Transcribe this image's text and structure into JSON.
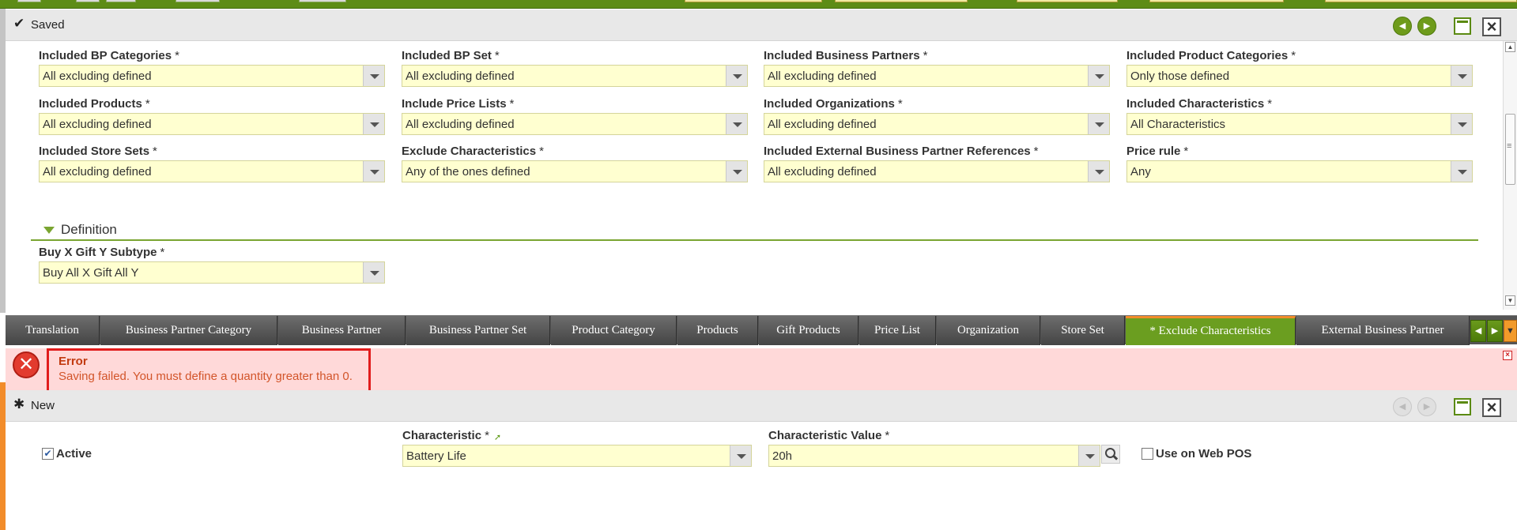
{
  "status_top": {
    "label": "Saved",
    "icon": "checkmark-icon"
  },
  "filters": [
    {
      "label": "Included BP Categories",
      "req": "*",
      "value": "All excluding defined"
    },
    {
      "label": "Included BP Set",
      "req": "*",
      "value": "All excluding defined"
    },
    {
      "label": "Included Business Partners",
      "req": "*",
      "value": "All excluding defined"
    },
    {
      "label": "Included Product Categories",
      "req": "*",
      "value": "Only those defined"
    },
    {
      "label": "Included Products",
      "req": "*",
      "value": "All excluding defined"
    },
    {
      "label": "Include Price Lists",
      "req": "*",
      "value": "All excluding defined"
    },
    {
      "label": "Included Organizations",
      "req": "*",
      "value": "All excluding defined"
    },
    {
      "label": "Included Characteristics",
      "req": "*",
      "value": "All Characteristics"
    },
    {
      "label": "Included Store Sets",
      "req": "*",
      "value": "All excluding defined"
    },
    {
      "label": "Exclude Characteristics",
      "req": "*",
      "value": "Any of the ones defined"
    },
    {
      "label": "Included External Business Partner References",
      "req": "*",
      "value": "All excluding defined"
    },
    {
      "label": "Price rule",
      "req": "*",
      "value": "Any"
    }
  ],
  "definition": {
    "title": "Definition",
    "subtype_label": "Buy X Gift Y Subtype",
    "subtype_req": "*",
    "subtype_value": "Buy All X Gift All Y"
  },
  "tabs": [
    "Translation",
    "Business Partner Category",
    "Business Partner",
    "Business Partner Set",
    "Product Category",
    "Products",
    "Gift Products",
    "Price List",
    "Organization",
    "Store Set",
    "* Exclude Characteristics",
    "External Business Partner"
  ],
  "active_tab": "* Exclude Characteristics",
  "error": {
    "title": "Error",
    "message": "Saving failed. You must define a quantity greater than 0."
  },
  "status_bottom": {
    "label": "New",
    "icon": "new-record-icon"
  },
  "record": {
    "active_label": "Active",
    "active_checked": true,
    "characteristic_label": "Characteristic",
    "characteristic_req": "*",
    "characteristic_value": "Battery Life",
    "char_value_label": "Characteristic Value",
    "char_value_req": "*",
    "char_value_value": "20h",
    "web_pos_label": "Use on Web POS",
    "web_pos_checked": false
  },
  "colors": {
    "accent": "#7aa531",
    "field_bg": "#ffffd0",
    "error_bg": "#ffd9d9",
    "error_border": "#e11c1c",
    "active_tab": "#6b9e20"
  }
}
